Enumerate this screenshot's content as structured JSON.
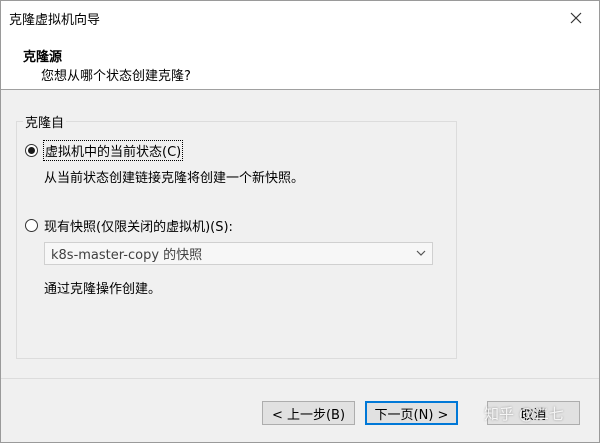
{
  "window": {
    "title": "克隆虚拟机向导"
  },
  "header": {
    "title": "克隆源",
    "subtitle": "您想从哪个状态创建克隆?"
  },
  "group": {
    "legend": "克隆自"
  },
  "option_current": {
    "label": "虚拟机中的当前状态(C)",
    "description": "从当前状态创建链接克隆将创建一个新快照。",
    "checked": true
  },
  "option_snapshot": {
    "label": "现有快照(仅限关闭的虚拟机)(S):",
    "select_value": "k8s-master-copy 的快照",
    "description": "通过克隆操作创建。",
    "checked": false
  },
  "buttons": {
    "back": "< 上一步(B)",
    "next": "下一页(N) >",
    "cancel": "取消"
  },
  "watermark": "知乎 @二七",
  "icons": {
    "close": "close-icon",
    "dropdown": "chevron-down-icon"
  }
}
